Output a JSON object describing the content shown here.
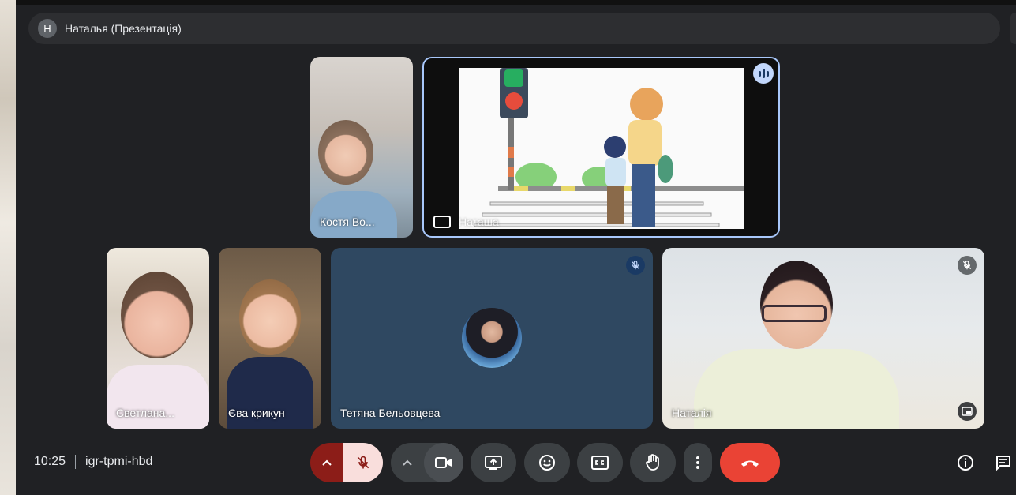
{
  "presentation": {
    "presenter_initial": "Н",
    "title": "Наталья (Презентація)"
  },
  "participants": {
    "kostya": {
      "name": "Костя Во..."
    },
    "screen_share": {
      "name": "Наташа"
    },
    "svetlana": {
      "name": "Светлана..."
    },
    "eva": {
      "name": "Єва крикун"
    },
    "tetyana": {
      "name": "Тетяна Бельовцева"
    },
    "natalia": {
      "name": "Наталія"
    }
  },
  "meeting": {
    "time": "10:25",
    "code": "igr-tpmi-hbd"
  },
  "icons": {
    "mic_toggle": "mic-off-icon",
    "camera": "video-camera-icon",
    "present": "present-screen-icon",
    "reactions": "emoji-icon",
    "captions": "closed-captions-icon",
    "raise_hand": "hand-icon",
    "more": "more-vert-icon",
    "end_call": "phone-hangup-icon",
    "info": "info-icon",
    "chat": "chat-icon"
  },
  "colors": {
    "background": "#202124",
    "end_call": "#ea4335",
    "mic_off_active": "#f9dedc",
    "mic_chevron": "#8c1d18",
    "active_speaker_border": "#a8c7fa"
  }
}
